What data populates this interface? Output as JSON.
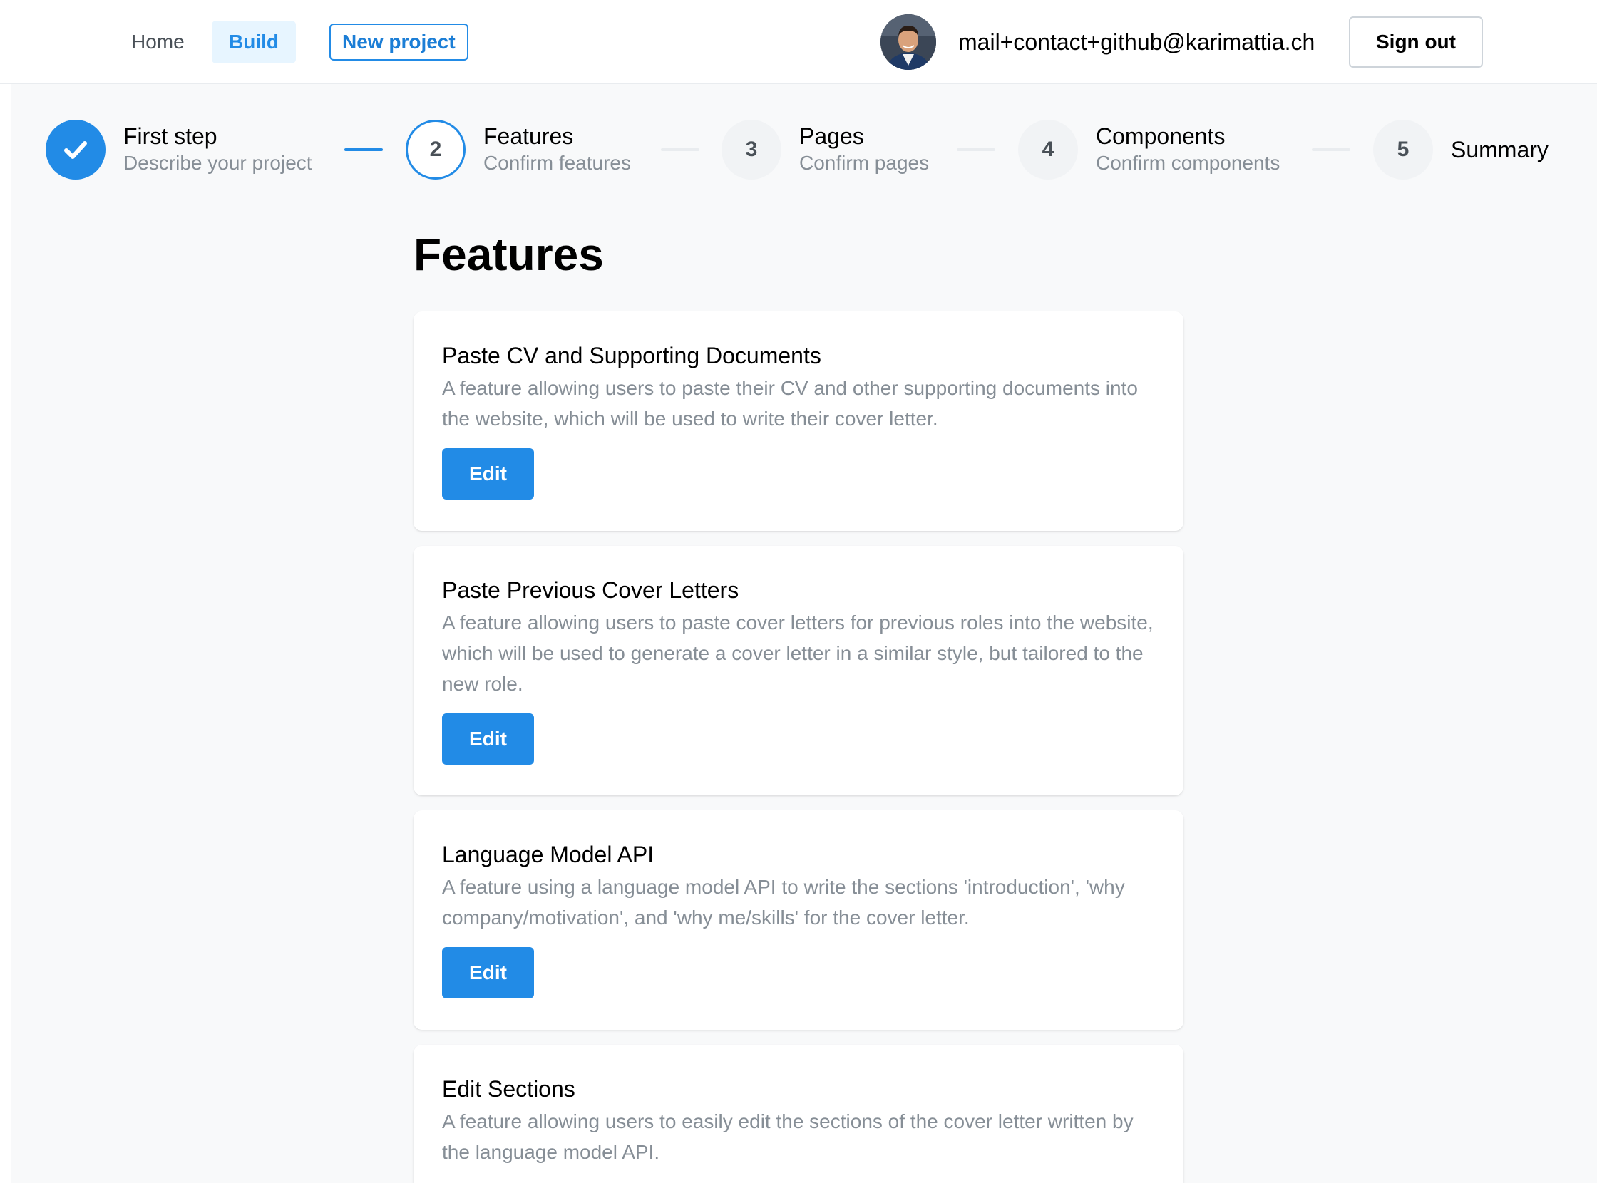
{
  "header": {
    "home_label": "Home",
    "build_label": "Build",
    "new_project_label": "New project",
    "user_email": "mail+contact+github@karimattia.ch",
    "sign_out_label": "Sign out"
  },
  "stepper": {
    "steps": [
      {
        "number": "",
        "title": "First step",
        "description": "Describe your project",
        "state": "done"
      },
      {
        "number": "2",
        "title": "Features",
        "description": "Confirm features",
        "state": "active"
      },
      {
        "number": "3",
        "title": "Pages",
        "description": "Confirm pages",
        "state": "pending"
      },
      {
        "number": "4",
        "title": "Components",
        "description": "Confirm components",
        "state": "pending"
      },
      {
        "number": "5",
        "title": "Summary",
        "description": "",
        "state": "pending"
      }
    ]
  },
  "main": {
    "title": "Features",
    "edit_label": "Edit",
    "features": [
      {
        "title": "Paste CV and Supporting Documents",
        "description": "A feature allowing users to paste their CV and other supporting documents into the website, which will be used to write their cover letter."
      },
      {
        "title": "Paste Previous Cover Letters",
        "description": "A feature allowing users to paste cover letters for previous roles into the website, which will be used to generate a cover letter in a similar style, but tailored to the new role."
      },
      {
        "title": "Language Model API",
        "description": "A feature using a language model API to write the sections 'introduction', 'why company/motivation', and 'why me/skills' for the cover letter."
      },
      {
        "title": "Edit Sections",
        "description": "A feature allowing users to easily edit the sections of the cover letter written by the language model API."
      }
    ]
  },
  "colors": {
    "accent": "#228be6",
    "accent_light": "#e7f5ff",
    "muted_text": "#868e96",
    "background": "#f8f9fa"
  },
  "icons": {
    "done_step": "check-icon",
    "avatar": "user-avatar"
  }
}
